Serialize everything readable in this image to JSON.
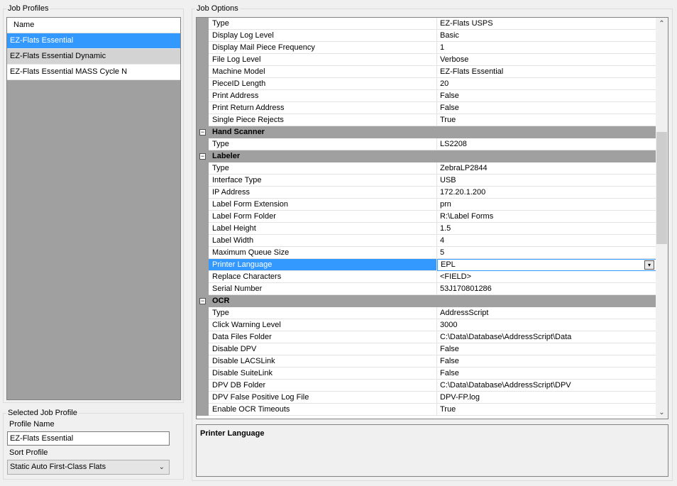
{
  "job_profiles": {
    "legend": "Job Profiles",
    "column_header": "Name",
    "items": [
      {
        "name": "EZ-Flats Essential",
        "state": "selected"
      },
      {
        "name": "EZ-Flats Essential Dynamic",
        "state": "alt"
      },
      {
        "name": "EZ-Flats Essential MASS Cycle N",
        "state": "normal"
      }
    ]
  },
  "selected_job_profile": {
    "legend": "Selected Job Profile",
    "profile_name_label": "Profile Name",
    "profile_name_value": "EZ-Flats Essential",
    "sort_profile_label": "Sort Profile",
    "sort_profile_value": "Static Auto First-Class Flats"
  },
  "job_options": {
    "legend": "Job Options",
    "rows": [
      {
        "kind": "prop",
        "name": "Type",
        "value": "EZ-Flats USPS"
      },
      {
        "kind": "prop",
        "name": "Display Log Level",
        "value": "Basic"
      },
      {
        "kind": "prop",
        "name": "Display Mail Piece Frequency",
        "value": "1"
      },
      {
        "kind": "prop",
        "name": "File Log Level",
        "value": "Verbose"
      },
      {
        "kind": "prop",
        "name": "Machine Model",
        "value": "EZ-Flats Essential"
      },
      {
        "kind": "prop",
        "name": "PieceID Length",
        "value": "20"
      },
      {
        "kind": "prop",
        "name": "Print Address",
        "value": "False"
      },
      {
        "kind": "prop",
        "name": "Print Return Address",
        "value": "False"
      },
      {
        "kind": "prop",
        "name": "Single Piece Rejects",
        "value": "True"
      },
      {
        "kind": "cat",
        "name": "Hand Scanner"
      },
      {
        "kind": "prop",
        "name": "Type",
        "value": "LS2208"
      },
      {
        "kind": "cat",
        "name": "Labeler"
      },
      {
        "kind": "prop",
        "name": "Type",
        "value": "ZebraLP2844"
      },
      {
        "kind": "prop",
        "name": "Interface Type",
        "value": "USB"
      },
      {
        "kind": "prop",
        "name": "IP Address",
        "value": "172.20.1.200"
      },
      {
        "kind": "prop",
        "name": "Label Form Extension",
        "value": "prn"
      },
      {
        "kind": "prop",
        "name": "Label Form Folder",
        "value": "R:\\Label Forms"
      },
      {
        "kind": "prop",
        "name": "Label Height",
        "value": "1.5"
      },
      {
        "kind": "prop",
        "name": "Label Width",
        "value": "4"
      },
      {
        "kind": "prop",
        "name": "Maximum Queue Size",
        "value": "5"
      },
      {
        "kind": "prop",
        "name": "Printer Language",
        "value": "EPL",
        "selected": true
      },
      {
        "kind": "prop",
        "name": "Replace Characters",
        "value": "<FIELD>"
      },
      {
        "kind": "prop",
        "name": "Serial Number",
        "value": "53J170801286"
      },
      {
        "kind": "cat",
        "name": "OCR"
      },
      {
        "kind": "prop",
        "name": "Type",
        "value": "AddressScript"
      },
      {
        "kind": "prop",
        "name": "Click Warning Level",
        "value": "3000"
      },
      {
        "kind": "prop",
        "name": "Data Files Folder",
        "value": "C:\\Data\\Database\\AddressScript\\Data"
      },
      {
        "kind": "prop",
        "name": "Disable DPV",
        "value": "False"
      },
      {
        "kind": "prop",
        "name": "Disable LACSLink",
        "value": "False"
      },
      {
        "kind": "prop",
        "name": "Disable SuiteLink",
        "value": "False"
      },
      {
        "kind": "prop",
        "name": "DPV DB Folder",
        "value": "C:\\Data\\Database\\AddressScript\\DPV"
      },
      {
        "kind": "prop",
        "name": "DPV False Positive Log File",
        "value": "DPV-FP.log"
      },
      {
        "kind": "prop",
        "name": "Enable OCR Timeouts",
        "value": "True"
      }
    ]
  },
  "description": {
    "title": "Printer Language"
  }
}
